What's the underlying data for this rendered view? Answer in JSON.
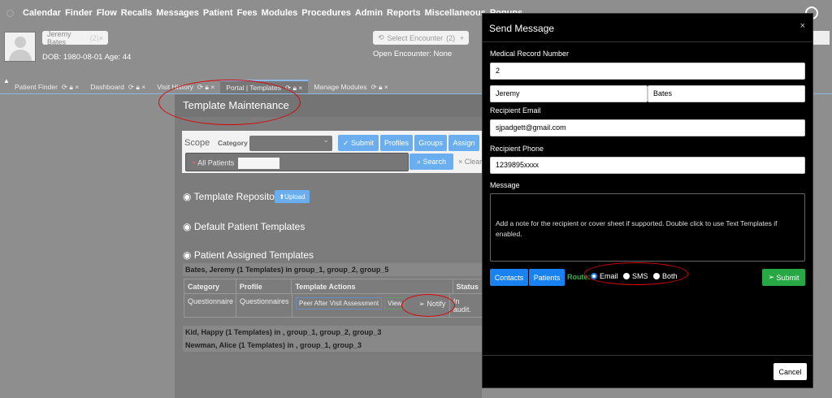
{
  "nav": [
    "Calendar",
    "Finder",
    "Flow",
    "Recalls",
    "Messages",
    "Patient",
    "Fees",
    "Modules",
    "Procedures",
    "Admin",
    "Reports",
    "Miscellaneous",
    "Popups"
  ],
  "patient": {
    "name": "Jeremy Bates",
    "count": "(2)",
    "dob": "DOB: 1980-08-01 Age: 44"
  },
  "encounter": {
    "select": "Select Encounter",
    "count": "(2)",
    "open": "Open Encounter: None"
  },
  "tabs": [
    "Patient Finder",
    "Dashboard",
    "Visit History",
    "Portal | Templates",
    "Manage Modules"
  ],
  "page": {
    "title": "Template Maintenance",
    "scope": "Scope",
    "category": "Category",
    "submit": "Submit",
    "profiles": "Profiles",
    "groups": "Groups",
    "assign": "Assign",
    "all_patients": "All Patients",
    "search": "Search",
    "clear": "Clear",
    "repo": "Template Repository",
    "upload": "Upload",
    "defaults": "Default Patient Templates",
    "assigned": "Patient Assigned Templates",
    "groups_rows": [
      "Bates, Jeremy (1 Templates) in group_1, group_2, group_5",
      "Kid, Happy (1 Templates) in , group_1, group_2, group_3",
      "Newman, Alice (1 Templates) in , group_1, group_3"
    ],
    "table": {
      "headers": [
        "Category",
        "Profile",
        "Template Actions",
        "Status"
      ],
      "row": {
        "category": "Questionnaire",
        "profile": "Questionnaires",
        "template": "Peer After Visit Assessment",
        "view": "View",
        "notify": "Notify",
        "status": "In audit."
      }
    }
  },
  "modal": {
    "title": "Send Message",
    "close": "×",
    "mrn_label": "Medical Record Number",
    "mrn": "2",
    "first": "Jeremy",
    "last": "Bates",
    "email_label": "Recipient Email",
    "email": "sjpadgett@gmail.com",
    "phone_label": "Recipient Phone",
    "phone": "1239895xxxx",
    "message_label": "Message",
    "message_placeholder": "Add a note for the recipient or cover sheet if supported. Double click to use Text Templates if enabled.",
    "contacts": "Contacts",
    "patients": "Patients",
    "route": "Route:",
    "route_options": [
      "Email",
      "SMS",
      "Both"
    ],
    "route_selected": "Email",
    "submit": "Submit",
    "cancel": "Cancel"
  }
}
